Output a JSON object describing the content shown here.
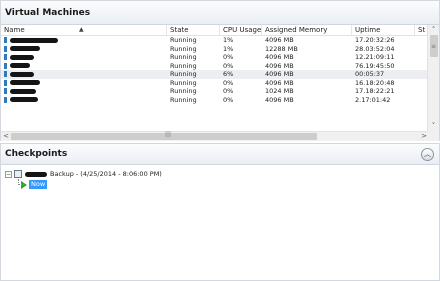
{
  "vm_pane": {
    "title": "Virtual Machines",
    "columns": [
      "Name",
      "State",
      "CPU Usage",
      "Assigned Memory",
      "Uptime",
      "St"
    ],
    "rows": [
      {
        "state": "Running",
        "cpu": "1%",
        "memory": "4096 MB",
        "uptime": "17.20:32:26",
        "redact_w": 48
      },
      {
        "state": "Running",
        "cpu": "1%",
        "memory": "12288 MB",
        "uptime": "28.03:52:04",
        "redact_w": 30
      },
      {
        "state": "Running",
        "cpu": "0%",
        "memory": "4096 MB",
        "uptime": "12.21:09:11",
        "redact_w": 24
      },
      {
        "state": "Running",
        "cpu": "0%",
        "memory": "4096 MB",
        "uptime": "76.19:45:50",
        "redact_w": 20
      },
      {
        "state": "Running",
        "cpu": "6%",
        "memory": "4096 MB",
        "uptime": "00:05:37",
        "redact_w": 24,
        "selected": true
      },
      {
        "state": "Running",
        "cpu": "0%",
        "memory": "4096 MB",
        "uptime": "16.18:20:48",
        "redact_w": 30
      },
      {
        "state": "Running",
        "cpu": "0%",
        "memory": "1024 MB",
        "uptime": "17.18:22:21",
        "redact_w": 26
      },
      {
        "state": "Running",
        "cpu": "0%",
        "memory": "4096 MB",
        "uptime": "2.17:01:42",
        "redact_w": 28
      }
    ]
  },
  "checkpoints_pane": {
    "title": "Checkpoints",
    "collapse_icon": "chevron-up-icon",
    "checkpoint_label": "Backup - (4/25/2014 - 8:06:00 PM)",
    "now_label": "Now"
  },
  "colors": {
    "selection_blue": "#3399ff",
    "vm_icon": "#2d7cc0",
    "play_green": "#2aa52a"
  }
}
